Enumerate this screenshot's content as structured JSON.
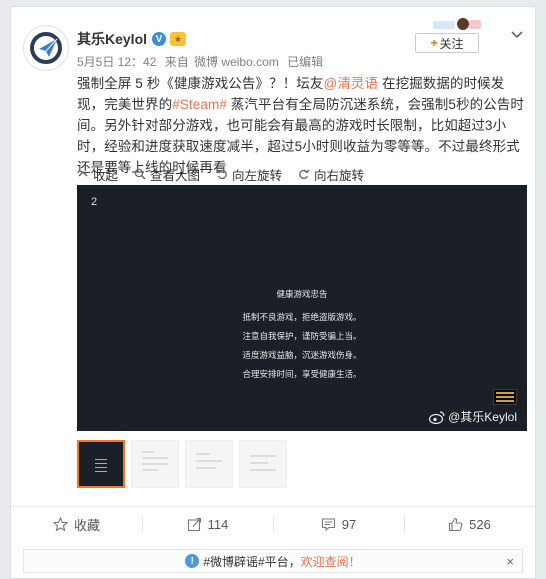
{
  "user": {
    "name": "其乐Keylol",
    "verified_badge": "V",
    "medal_badge": "🏅",
    "time": "5月5日 12：42",
    "source_prefix": "来自",
    "source": "微博 weibo.com",
    "edited": "已编辑",
    "follow_label": "关注",
    "follow_plus": "+"
  },
  "post": {
    "text_before_1": "强制全屏 5 秒《健康游戏公告》？！坛友",
    "mention": "@清灵语",
    "text_mid_1": " 在挖掘数据的时候发现，完美世界的",
    "hashtag": "#Steam#",
    "text_after": " 蒸汽平台有全局防沉迷系统，会强制5秒的公告时间。另外针对部分游戏，也可能会有最高的游戏时长限制，比如超过3小时，经验和进度获取速度减半，超过5小时则收益为零等等。不过最终形式还是要等上线的时候再看"
  },
  "toolbar": {
    "collapse": "收起",
    "view_large": "查看大图",
    "rotate_left": "向左旋转",
    "rotate_right": "向右旋转"
  },
  "image": {
    "page_number": "2",
    "notice_title": "健康游戏忠告",
    "notice_lines": [
      "抵制不良游戏，拒绝盗版游戏。",
      "注意自我保护，谨防受骗上当。",
      "适度游戏益脑，沉迷游戏伤身。",
      "合理安排时间，享受健康生活。"
    ],
    "watermark": "@其乐Keylol"
  },
  "thumbnails": [
    {
      "active": true
    },
    {
      "active": false
    },
    {
      "active": false
    },
    {
      "active": false
    }
  ],
  "actions": {
    "favorite": "收藏",
    "repost_count": "114",
    "comment_count": "97",
    "like_count": "526"
  },
  "banner": {
    "info_icon": "!",
    "text": "#微博辟谣#平台，",
    "link": "欢迎查阅！",
    "close": "×"
  },
  "colors": {
    "link": "#eb7350",
    "verified": "#3b8ce0",
    "image_bg": "#1b1f27",
    "active_thumb_border": "#f5761e"
  }
}
